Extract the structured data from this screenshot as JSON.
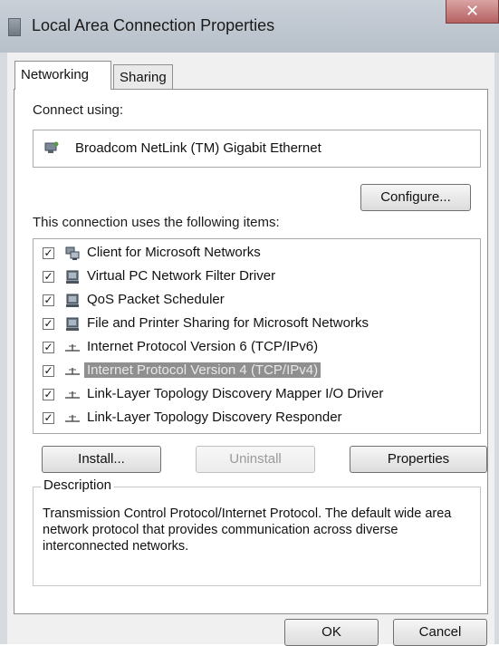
{
  "window": {
    "title": "Local Area Connection Properties",
    "close_label": "✕"
  },
  "tabs": [
    {
      "label": "Networking",
      "active": true
    },
    {
      "label": "Sharing",
      "active": false
    }
  ],
  "connect_using": {
    "label": "Connect using:",
    "adapter": "Broadcom NetLink (TM) Gigabit Ethernet",
    "adapter_icon": "network-adapter-icon"
  },
  "configure_label": "Configure...",
  "items_label": "This connection uses the following items:",
  "items": [
    {
      "label": "Client for Microsoft Networks",
      "checked": true,
      "icon": "client-icon"
    },
    {
      "label": "Virtual PC Network Filter Driver",
      "checked": true,
      "icon": "service-icon"
    },
    {
      "label": "QoS Packet Scheduler",
      "checked": true,
      "icon": "service-icon"
    },
    {
      "label": "File and Printer Sharing for Microsoft Networks",
      "checked": true,
      "icon": "service-icon"
    },
    {
      "label": "Internet Protocol Version 6 (TCP/IPv6)",
      "checked": true,
      "icon": "protocol-icon"
    },
    {
      "label": "Internet Protocol Version 4 (TCP/IPv4)",
      "checked": true,
      "icon": "protocol-icon",
      "selected": true
    },
    {
      "label": "Link-Layer Topology Discovery Mapper I/O Driver",
      "checked": true,
      "icon": "protocol-icon"
    },
    {
      "label": "Link-Layer Topology Discovery Responder",
      "checked": true,
      "icon": "protocol-icon"
    }
  ],
  "buttons": {
    "install": "Install...",
    "uninstall": "Uninstall",
    "properties": "Properties"
  },
  "description": {
    "legend": "Description",
    "text": "Transmission Control Protocol/Internet Protocol. The default wide area network protocol that provides communication across diverse interconnected networks."
  },
  "footer": {
    "ok": "OK",
    "cancel": "Cancel"
  }
}
